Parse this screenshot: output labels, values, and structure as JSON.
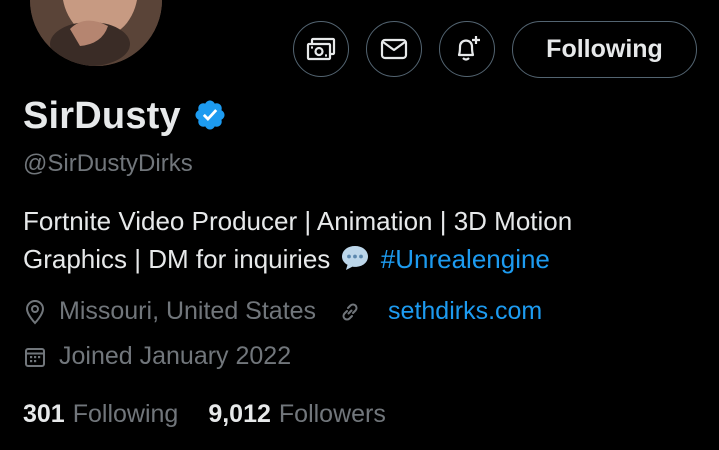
{
  "profile": {
    "display_name": "SirDusty",
    "handle": "@SirDustyDirks",
    "verified": true,
    "bio": {
      "line1": "Fortnite Video Producer | Animation | 3D Motion",
      "line2_text": "Graphics | DM for inquiries",
      "line2_emoji": "speech-bubble-icon",
      "hashtag": "#Unrealengine"
    },
    "location": "Missouri, United States",
    "website": "sethdirks.com",
    "joined": "Joined January 2022"
  },
  "actions": {
    "tip_icon": "money-icon",
    "message_icon": "mail-icon",
    "notify_icon": "bell-plus-icon",
    "follow_label": "Following"
  },
  "stats": {
    "following_count": "301",
    "following_label": "Following",
    "followers_count": "9,012",
    "followers_label": "Followers"
  },
  "colors": {
    "background": "#000000",
    "text": "#e7e9ea",
    "muted": "#71767b",
    "accent": "#1d9bf0",
    "border": "#536471"
  }
}
